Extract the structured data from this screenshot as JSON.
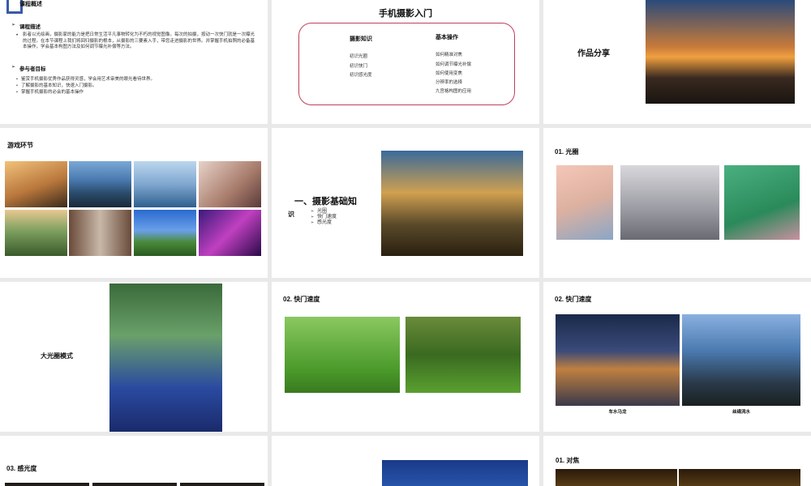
{
  "slides": {
    "overview": {
      "title": "课程概述",
      "section1": "课程描述",
      "desc": "影者以光绘画，摄影家的能力是把日常生活平凡事物转化为不朽的视觉图像。每次的拍摄，按动一次快门就是一次曝光的过程。在本节课程上我们将回归摄影的根本，从摄影的三要素入手，带您走进摄影的世界。并掌握手机拍照的必备基本操作，学会基本构图方法及如何调节曝光补偿等方法。",
      "section2": "参与者目标",
      "goals": [
        "鉴赏手机摄影优秀作品获得灵感，学会用艺术审美的眼光看待世界。",
        "了解摄影的基本知识，快速入门摄影。",
        "掌握手机摄影的必会的基本操作"
      ]
    },
    "intro": {
      "title": "手机摄影入门",
      "col1_head": "摄影知识",
      "col1_items": [
        "初识光圈",
        "初识快门",
        "初识感光度"
      ],
      "col2_head": "基本操作",
      "col2_items": [
        "如何精准对焦",
        "如何调节曝光补偿",
        "如何使用变焦",
        "分辨率的选择",
        "九宫格构图的应用"
      ]
    },
    "works": {
      "title": "作品分享"
    },
    "game": {
      "title": "游戏环节"
    },
    "basics": {
      "title_line1": "一、摄影基础知",
      "title_line2": "识",
      "items": [
        "光圈",
        "快门速度",
        "感光度"
      ]
    },
    "aperture": {
      "title": "01. 光圈"
    },
    "big_aperture": {
      "title": "大光圈模式"
    },
    "shutter1": {
      "title": "02. 快门速度"
    },
    "shutter2": {
      "title": "02. 快门速度",
      "caption1": "车水马龙",
      "caption2": "丝绢流水"
    },
    "iso": {
      "title": "03. 感光度"
    },
    "focus": {
      "title": "01. 对焦"
    }
  }
}
